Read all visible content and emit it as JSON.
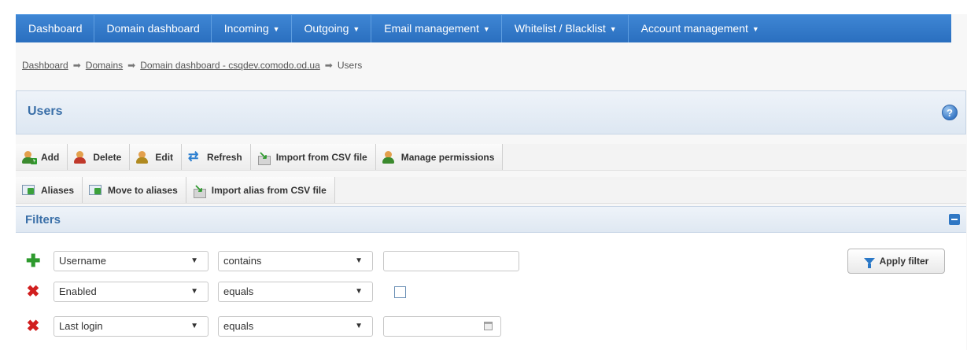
{
  "nav": {
    "items": [
      {
        "label": "Dashboard",
        "dropdown": false
      },
      {
        "label": "Domain dashboard",
        "dropdown": false
      },
      {
        "label": "Incoming",
        "dropdown": true
      },
      {
        "label": "Outgoing",
        "dropdown": true
      },
      {
        "label": "Email management",
        "dropdown": true
      },
      {
        "label": "Whitelist / Blacklist",
        "dropdown": true
      },
      {
        "label": "Account management",
        "dropdown": true
      }
    ]
  },
  "breadcrumb": {
    "items": [
      "Dashboard",
      "Domains",
      "Domain dashboard - csqdev.comodo.od.ua"
    ],
    "current": "Users"
  },
  "page": {
    "title": "Users"
  },
  "toolbar": {
    "add": "Add",
    "delete": "Delete",
    "edit": "Edit",
    "refresh": "Refresh",
    "import_csv": "Import from CSV file",
    "manage_permissions": "Manage permissions",
    "aliases": "Aliases",
    "move_to_aliases": "Move to aliases",
    "import_alias_csv": "Import alias from CSV file"
  },
  "filters": {
    "title": "Filters",
    "apply_label": "Apply filter",
    "rows": [
      {
        "field": "Username",
        "operator": "contains",
        "value": ""
      },
      {
        "field": "Enabled",
        "operator": "equals",
        "checked": false
      },
      {
        "field": "Last login",
        "operator": "equals",
        "value": ""
      }
    ]
  },
  "colors": {
    "nav_bg": "#2f77c9",
    "title_blue": "#3a6fa8",
    "remove_red": "#d11f1f",
    "add_green": "#2e9a2e"
  }
}
